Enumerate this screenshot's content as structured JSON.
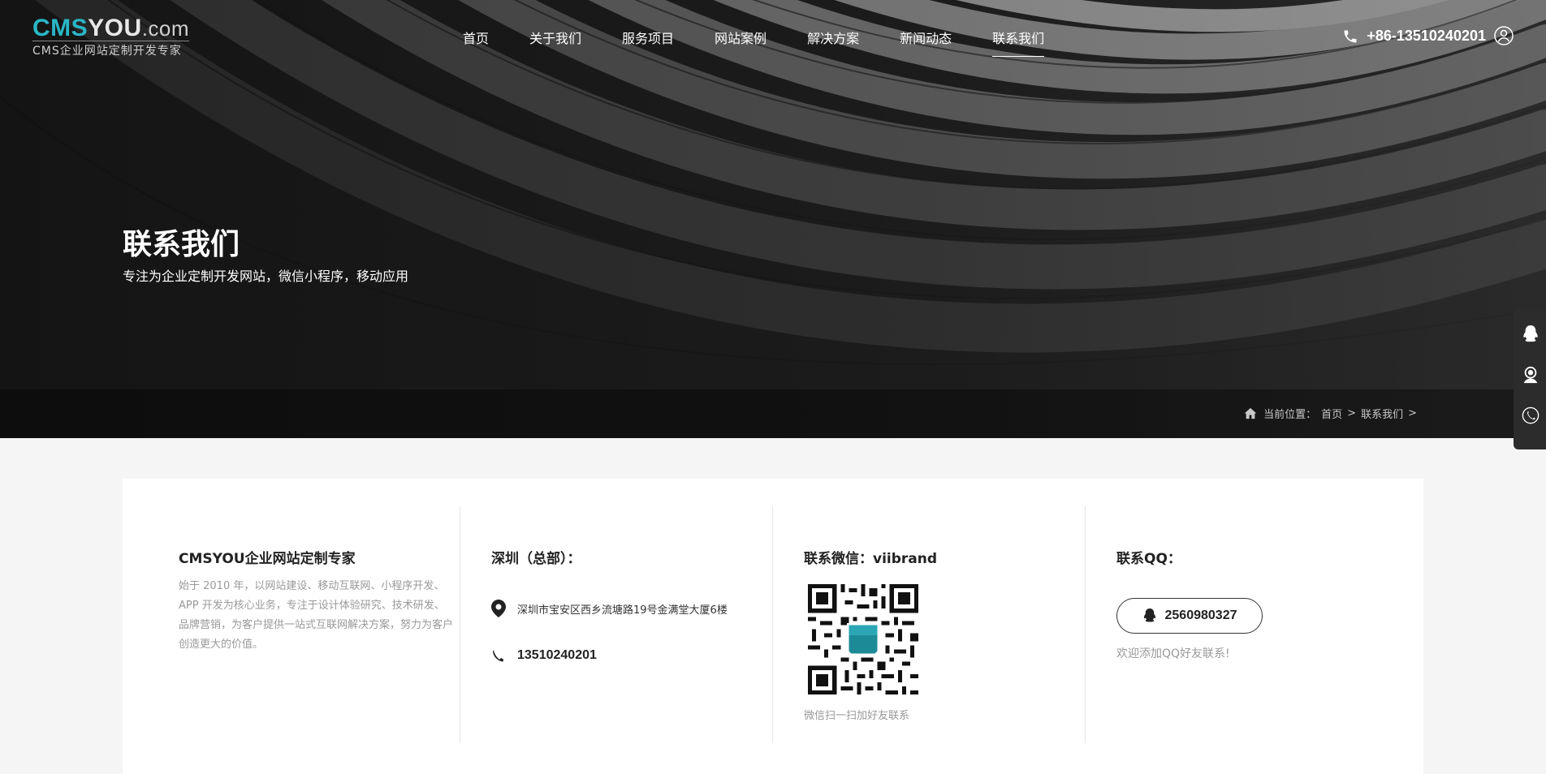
{
  "logo": {
    "cms": "CMS",
    "you": "YOU",
    "domain": ".com",
    "tagline": "CMS企业网站定制开发专家"
  },
  "nav": {
    "items": [
      {
        "label": "首页"
      },
      {
        "label": "关于我们"
      },
      {
        "label": "服务项目"
      },
      {
        "label": "网站案例"
      },
      {
        "label": "解决方案"
      },
      {
        "label": "新闻动态"
      },
      {
        "label": "联系我们",
        "active": true
      }
    ]
  },
  "header": {
    "phone": "+86-13510240201"
  },
  "hero": {
    "title": "联系我们",
    "subtitle": "专注为企业定制开发网站，微信小程序，移动应用"
  },
  "breadcrumb": {
    "prefix": "当前位置：",
    "home": "首页",
    "sep1": ">",
    "current": "联系我们",
    "sep2": ">"
  },
  "about": {
    "title": "CMSYOU企业网站定制专家",
    "desc": "始于 2010 年，以网站建设、移动互联网、小程序开发、APP 开发为核心业务，专注于设计体验研究、技术研发、品牌营销，为客户提供一站式互联网解决方案，努力为客户创造更大的价值。"
  },
  "office": {
    "title": "深圳（总部）：",
    "address": "深圳市宝安区西乡流塘路19号金满堂大厦6楼",
    "phone": "13510240201"
  },
  "wechat": {
    "title": "联系微信：viibrand",
    "caption": "微信扫一扫加好友联系"
  },
  "qq": {
    "title": "联系QQ：",
    "number": "2560980327",
    "caption": "欢迎添加QQ好友联系!"
  },
  "colors": {
    "brand": "#29b6c6",
    "text": "#222222",
    "muted": "#999999"
  }
}
